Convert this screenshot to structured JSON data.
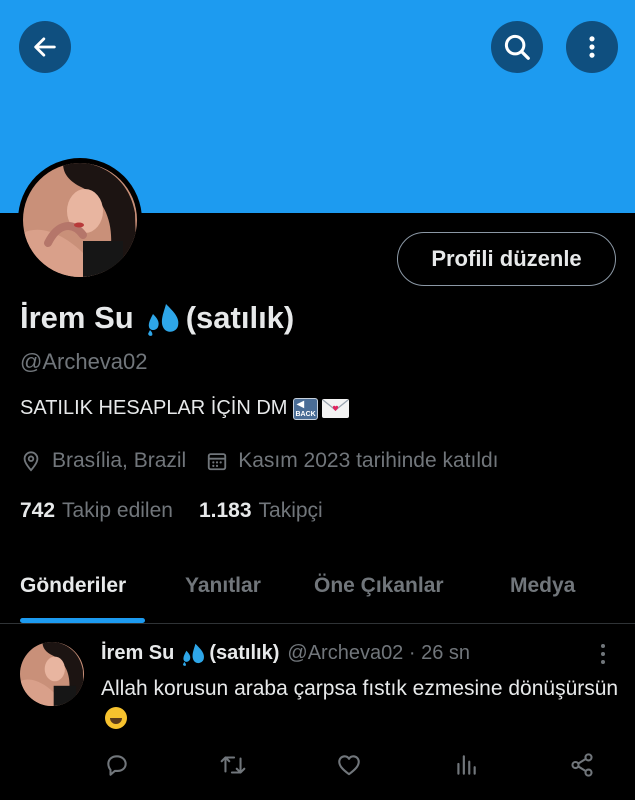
{
  "header": {
    "icons": [
      "arrow-left-icon",
      "search-icon",
      "more-vertical-icon"
    ],
    "banner_color": "#1d9bf0"
  },
  "profile": {
    "edit_button": "Profili düzenle",
    "name": "İrem Su",
    "name_suffix": "(satılık)",
    "handle": "@Archeva02",
    "bio": "SATILIK HESAPLAR İÇİN DM",
    "bio_back_emoji": "BACK",
    "location": "Brasília, Brazil",
    "joined": "Kasım 2023 tarihinde katıldı",
    "following_count": "742",
    "following_label": "Takip edilen",
    "followers_count": "1.183",
    "followers_label": "Takipçi"
  },
  "tabs": [
    {
      "label": "Gönderiler",
      "active": true
    },
    {
      "label": "Yanıtlar",
      "active": false
    },
    {
      "label": "Öne Çıkanlar",
      "active": false
    },
    {
      "label": "Medya",
      "active": false
    }
  ],
  "tweet": {
    "name": "İrem Su",
    "name_suffix": "(satılık)",
    "meta": "@Archeva02 · 26 sn",
    "text": "Allah korusun araba çarpsa fıstık ezmesine dönüşürsün",
    "actions": [
      "reply-icon",
      "retweet-icon",
      "like-icon",
      "views-icon",
      "share-icon"
    ]
  },
  "colors": {
    "accent": "#1d9bf0",
    "muted_text": "#71767b",
    "text": "#e7e9ea",
    "background": "#000000"
  }
}
